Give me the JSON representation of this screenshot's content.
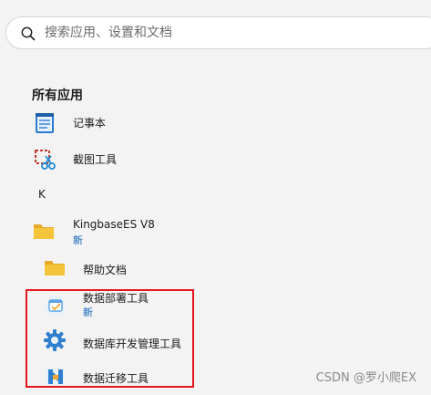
{
  "search": {
    "placeholder": "搜索应用、设置和文档"
  },
  "all_apps": {
    "title": "所有应用"
  },
  "apps": [
    {
      "label": "记事本",
      "icon": "notepad-icon"
    },
    {
      "label": "截图工具",
      "icon": "snipping-tool-icon"
    }
  ],
  "letter_group": {
    "label": "K"
  },
  "kingbase": {
    "label": "KingbaseES V8",
    "badge": "新",
    "icon": "folder-icon"
  },
  "kingbase_children": [
    {
      "label": "帮助文档",
      "icon": "folder-icon"
    },
    {
      "label": "数据部署工具",
      "badge": "新",
      "icon": "deploy-tool-icon"
    },
    {
      "label": "数据库开发管理工具",
      "icon": "db-gear-icon"
    },
    {
      "label": "数据迁移工具",
      "icon": "migration-icon"
    }
  ],
  "watermark": "CSDN @罗小爬EX",
  "colors": {
    "background": "#f3f3f3",
    "badge": "#0f5fb8",
    "highlight": "#e4161c",
    "folder": "#f4c43a"
  }
}
